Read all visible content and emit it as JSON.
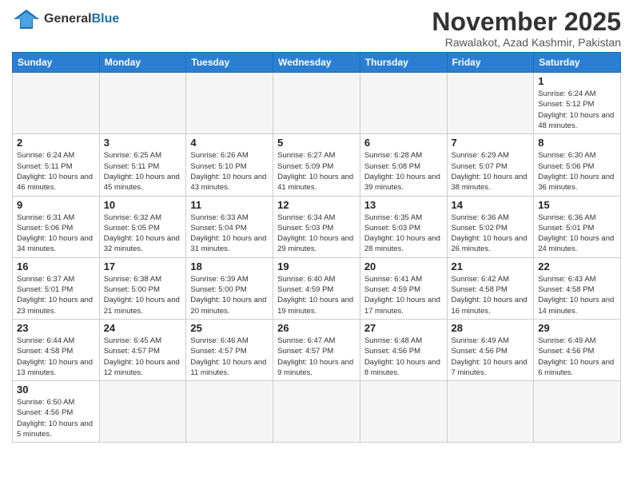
{
  "logo": {
    "general": "General",
    "blue": "Blue"
  },
  "title": "November 2025",
  "subtitle": "Rawalakot, Azad Kashmir, Pakistan",
  "days_of_week": [
    "Sunday",
    "Monday",
    "Tuesday",
    "Wednesday",
    "Thursday",
    "Friday",
    "Saturday"
  ],
  "weeks": [
    [
      {
        "day": "",
        "info": ""
      },
      {
        "day": "",
        "info": ""
      },
      {
        "day": "",
        "info": ""
      },
      {
        "day": "",
        "info": ""
      },
      {
        "day": "",
        "info": ""
      },
      {
        "day": "",
        "info": ""
      },
      {
        "day": "1",
        "info": "Sunrise: 6:24 AM\nSunset: 5:12 PM\nDaylight: 10 hours\nand 48 minutes."
      }
    ],
    [
      {
        "day": "2",
        "info": "Sunrise: 6:24 AM\nSunset: 5:11 PM\nDaylight: 10 hours\nand 46 minutes."
      },
      {
        "day": "3",
        "info": "Sunrise: 6:25 AM\nSunset: 5:11 PM\nDaylight: 10 hours\nand 45 minutes."
      },
      {
        "day": "4",
        "info": "Sunrise: 6:26 AM\nSunset: 5:10 PM\nDaylight: 10 hours\nand 43 minutes."
      },
      {
        "day": "5",
        "info": "Sunrise: 6:27 AM\nSunset: 5:09 PM\nDaylight: 10 hours\nand 41 minutes."
      },
      {
        "day": "6",
        "info": "Sunrise: 6:28 AM\nSunset: 5:08 PM\nDaylight: 10 hours\nand 39 minutes."
      },
      {
        "day": "7",
        "info": "Sunrise: 6:29 AM\nSunset: 5:07 PM\nDaylight: 10 hours\nand 38 minutes."
      },
      {
        "day": "8",
        "info": "Sunrise: 6:30 AM\nSunset: 5:06 PM\nDaylight: 10 hours\nand 36 minutes."
      }
    ],
    [
      {
        "day": "9",
        "info": "Sunrise: 6:31 AM\nSunset: 5:06 PM\nDaylight: 10 hours\nand 34 minutes."
      },
      {
        "day": "10",
        "info": "Sunrise: 6:32 AM\nSunset: 5:05 PM\nDaylight: 10 hours\nand 32 minutes."
      },
      {
        "day": "11",
        "info": "Sunrise: 6:33 AM\nSunset: 5:04 PM\nDaylight: 10 hours\nand 31 minutes."
      },
      {
        "day": "12",
        "info": "Sunrise: 6:34 AM\nSunset: 5:03 PM\nDaylight: 10 hours\nand 29 minutes."
      },
      {
        "day": "13",
        "info": "Sunrise: 6:35 AM\nSunset: 5:03 PM\nDaylight: 10 hours\nand 28 minutes."
      },
      {
        "day": "14",
        "info": "Sunrise: 6:36 AM\nSunset: 5:02 PM\nDaylight: 10 hours\nand 26 minutes."
      },
      {
        "day": "15",
        "info": "Sunrise: 6:36 AM\nSunset: 5:01 PM\nDaylight: 10 hours\nand 24 minutes."
      }
    ],
    [
      {
        "day": "16",
        "info": "Sunrise: 6:37 AM\nSunset: 5:01 PM\nDaylight: 10 hours\nand 23 minutes."
      },
      {
        "day": "17",
        "info": "Sunrise: 6:38 AM\nSunset: 5:00 PM\nDaylight: 10 hours\nand 21 minutes."
      },
      {
        "day": "18",
        "info": "Sunrise: 6:39 AM\nSunset: 5:00 PM\nDaylight: 10 hours\nand 20 minutes."
      },
      {
        "day": "19",
        "info": "Sunrise: 6:40 AM\nSunset: 4:59 PM\nDaylight: 10 hours\nand 19 minutes."
      },
      {
        "day": "20",
        "info": "Sunrise: 6:41 AM\nSunset: 4:59 PM\nDaylight: 10 hours\nand 17 minutes."
      },
      {
        "day": "21",
        "info": "Sunrise: 6:42 AM\nSunset: 4:58 PM\nDaylight: 10 hours\nand 16 minutes."
      },
      {
        "day": "22",
        "info": "Sunrise: 6:43 AM\nSunset: 4:58 PM\nDaylight: 10 hours\nand 14 minutes."
      }
    ],
    [
      {
        "day": "23",
        "info": "Sunrise: 6:44 AM\nSunset: 4:58 PM\nDaylight: 10 hours\nand 13 minutes."
      },
      {
        "day": "24",
        "info": "Sunrise: 6:45 AM\nSunset: 4:57 PM\nDaylight: 10 hours\nand 12 minutes."
      },
      {
        "day": "25",
        "info": "Sunrise: 6:46 AM\nSunset: 4:57 PM\nDaylight: 10 hours\nand 11 minutes."
      },
      {
        "day": "26",
        "info": "Sunrise: 6:47 AM\nSunset: 4:57 PM\nDaylight: 10 hours\nand 9 minutes."
      },
      {
        "day": "27",
        "info": "Sunrise: 6:48 AM\nSunset: 4:56 PM\nDaylight: 10 hours\nand 8 minutes."
      },
      {
        "day": "28",
        "info": "Sunrise: 6:49 AM\nSunset: 4:56 PM\nDaylight: 10 hours\nand 7 minutes."
      },
      {
        "day": "29",
        "info": "Sunrise: 6:49 AM\nSunset: 4:56 PM\nDaylight: 10 hours\nand 6 minutes."
      }
    ],
    [
      {
        "day": "30",
        "info": "Sunrise: 6:50 AM\nSunset: 4:56 PM\nDaylight: 10 hours\nand 5 minutes."
      },
      {
        "day": "",
        "info": ""
      },
      {
        "day": "",
        "info": ""
      },
      {
        "day": "",
        "info": ""
      },
      {
        "day": "",
        "info": ""
      },
      {
        "day": "",
        "info": ""
      },
      {
        "day": "",
        "info": ""
      }
    ]
  ]
}
